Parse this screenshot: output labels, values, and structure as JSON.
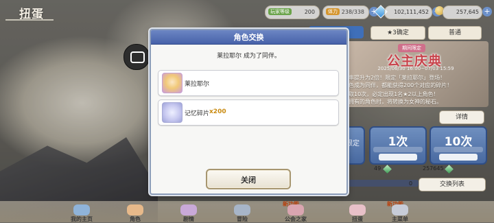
{
  "header": {
    "title": "扭蛋"
  },
  "status": {
    "level_label": "玩家等级",
    "level_value": "200",
    "stamina_label": "体力",
    "stamina_value": "238/338",
    "gems": "102,111,452",
    "jewels": "257,645"
  },
  "tabs": [
    {
      "label": ""
    },
    {
      "label": "★3确定"
    },
    {
      "label": "普通"
    }
  ],
  "banner": {
    "tag": "期间限定",
    "title": "公主庆典",
    "date": "2025/06/30 16:00~07/03 15:59",
    "lines": [
      "出率提升为2倍！限定「莱拉耶尔」登场！",
      "角色成为同伴，都能获得200个对应的碎片！",
      "抽取10次，必定出现1名★2以上角色！",
      "已拥有的角色时，将转换为女神的秘石。"
    ]
  },
  "buttons": {
    "detail": "详情",
    "limit": "限定",
    "gacha_one": "1次",
    "gacha_ten": "10次",
    "exchange": "交换列表"
  },
  "counters": {
    "left": "49",
    "right": "257645",
    "zero_a": "0",
    "zero_b": "0"
  },
  "nav": [
    {
      "label": "我的主页",
      "new": ""
    },
    {
      "label": "角色",
      "new": ""
    },
    {
      "label": "剧情",
      "new": ""
    },
    {
      "label": "冒险",
      "new": ""
    },
    {
      "label": "公会之家",
      "new": "新功能"
    },
    {
      "label": "扭蛋",
      "new": ""
    },
    {
      "label": "主菜单",
      "new": "新功能"
    }
  ],
  "modal": {
    "title": "角色交换",
    "message": "莱拉耶尔 成为了同伴。",
    "items": [
      {
        "name": "莱拉耶尔",
        "qty": ""
      },
      {
        "name": "记忆碎片",
        "qty": "x200"
      }
    ],
    "close_label": "关闭"
  },
  "colors": {
    "modal_header": "#4762a9",
    "accent_qty": "#c98a10",
    "tab_active": "#3f6fb9"
  }
}
